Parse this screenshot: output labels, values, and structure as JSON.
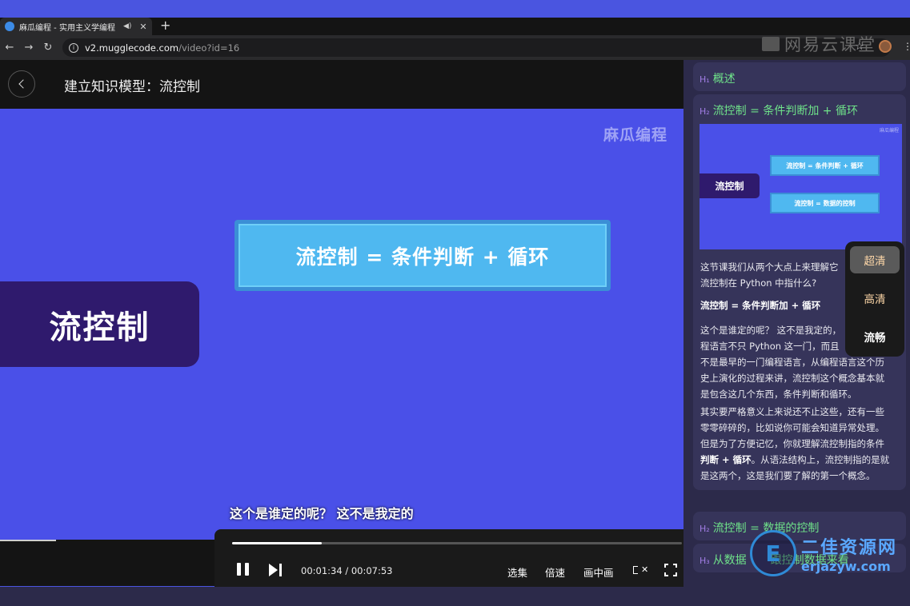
{
  "browser": {
    "tab_title": "麻瓜编程 - 实用主义学编程",
    "new_tab": "+",
    "url_host": "v2.mugglecode.com",
    "url_path": "/video?id=16",
    "watermark_top": "网易云课堂"
  },
  "video": {
    "title": "建立知识模型：流控制",
    "brand": "麻瓜编程",
    "formula": "流控制 = 条件判断 + 循环",
    "flow_label": "流控制",
    "subtitle": "这个是谁定的呢？ 这不是我定的",
    "progress": 0.2
  },
  "controls": {
    "current_time": "00:01:34",
    "separator": "/",
    "total_time": "00:07:53",
    "select_episode": "选集",
    "speed": "倍速",
    "pip": "画中画"
  },
  "quality_menu": {
    "options": [
      "超清",
      "高清",
      "流畅"
    ],
    "selected": "超清"
  },
  "panel": {
    "h1_tag": "H₁",
    "h1_title": "概述",
    "h2_tag": "H₂",
    "h2_title": "流控制 = 条件判断加 + 循环",
    "thumb_brand": "麻瓜编程",
    "thumb_flow": "流控制",
    "thumb_f1": "流控制 = 条件判断 + 循环",
    "thumb_f2": "流控制 = 数据的控制",
    "p1a": "这节课我们从两个大点上来理解它",
    "p1b": "流控制在 Python 中指什么?",
    "p2": "流控制 = 条件判断加 + 循环",
    "p3a": "这个是谁定的呢？ 这不是我定的，",
    "p3b": "程语言不只 Python 这一门，而且",
    "p3c": "不是最早的一门编程语言，从编程语言这个历",
    "p3d": "史上演化的过程来讲，流控制这个概念基本就",
    "p3e": "是包含这几个东西，条件判断和循环。",
    "p4a": "其实要严格意义上来说还不止这些，还有一些",
    "p4b": "零零碎碎的，比如说你可能会知道异常处理。",
    "p4c": "但是为了方便记忆，你就理解流控制指的条件",
    "p4d_bold": "判断 + 循环",
    "p4d_rest": "。从语法结构上，流控制指的是就",
    "p4e": "是这两个，这是我们要了解的第一个概念。",
    "h2b_tag": "H₂",
    "h2b_title": "流控制 = 数据的控制",
    "h3_tag": "H₃",
    "h3_title": "从数据",
    "h3_rest": "跟控制数据来看"
  },
  "watermark_bottom": {
    "logo": "E",
    "cn": "二佳资源网",
    "url": "erjazyw.com"
  }
}
